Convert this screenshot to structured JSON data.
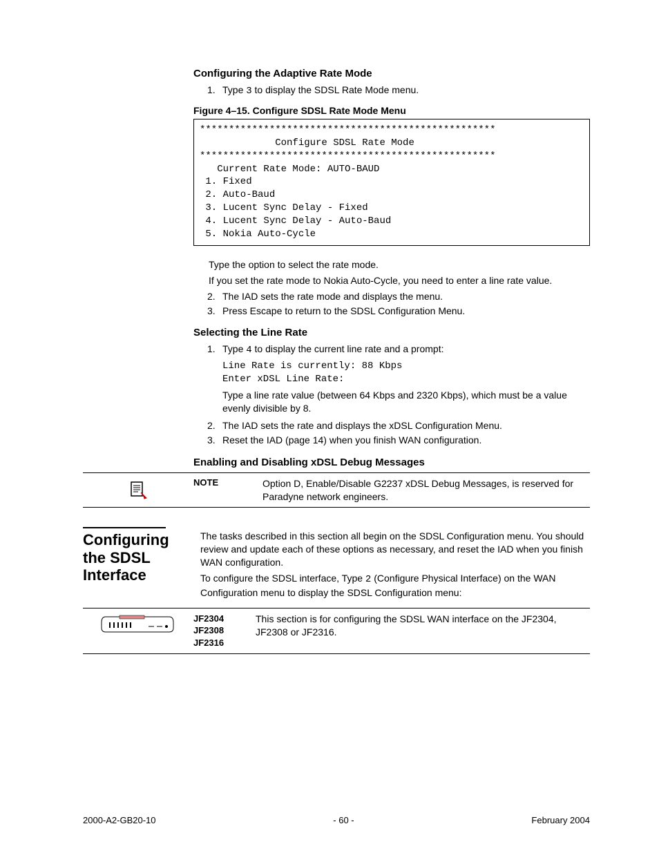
{
  "headings": {
    "h1": "Configuring the Adaptive Rate Mode",
    "h2": "Selecting the Line Rate",
    "h3": "Enabling and Disabling xDSL Debug Messages"
  },
  "step1": {
    "num": "1.",
    "pre": "Type ",
    "code": "3",
    "post": " to display the SDSL Rate Mode menu."
  },
  "figure": {
    "caption": "Figure 4–15.  Configure SDSL Rate Mode Menu",
    "code": "***************************************************\n             Configure SDSL Rate Mode\n***************************************************\n   Current Rate Mode: AUTO-BAUD\n 1. Fixed\n 2. Auto-Baud\n 3. Lucent Sync Delay - Fixed\n 4. Lucent Sync Delay - Auto-Baud\n 5. Nokia Auto-Cycle"
  },
  "after_fig": {
    "p1": "Type the option to select the rate mode.",
    "p2": "If you set the rate mode to Nokia Auto-Cycle, you need to enter a line rate value."
  },
  "step2": {
    "num": "2.",
    "text": "The IAD sets the rate mode and displays the menu."
  },
  "step3": {
    "num": "3.",
    "text": "Press Escape to return to the SDSL Configuration Menu."
  },
  "line_rate": {
    "s1": {
      "num": "1.",
      "pre": "Type ",
      "code": "4",
      "post": " to display the current line rate and a prompt:"
    },
    "code1": "Line Rate is currently: 88 Kbps",
    "code2": "Enter xDSL Line Rate:",
    "p1": "Type a line rate value (between 64 Kbps and 2320 Kbps), which must be a value evenly divisible by 8.",
    "s2": {
      "num": "2.",
      "text": "The IAD sets the rate and displays the xDSL Configuration Menu."
    },
    "s3": {
      "num": "3.",
      "text": "Reset the IAD (page 14) when you finish WAN configuration."
    }
  },
  "note": {
    "label": "NOTE",
    "text": "Option D, Enable/Disable G2237 xDSL Debug Messages, is reserved for Paradyne network engineers."
  },
  "section": {
    "title": "Configuring the SDSL Interface",
    "p1": "The tasks described in this section all begin on the SDSL Configuration menu. You should review and update each of these options as necessary, and reset the IAD when you finish WAN configuration.",
    "p2_pre": "To configure the SDSL interface, Type ",
    "p2_code": "2",
    "p2_post": " (Configure Physical Interface) on the WAN Configuration menu to display the SDSL Configuration menu:"
  },
  "device": {
    "m1": "JF2304",
    "m2": "JF2308",
    "m3": "JF2316",
    "text": "This section is for configuring the SDSL WAN interface on the JF2304, JF2308 or JF2316."
  },
  "footer": {
    "left": "2000-A2-GB20-10",
    "center": "- 60 -",
    "right": "February 2004"
  }
}
